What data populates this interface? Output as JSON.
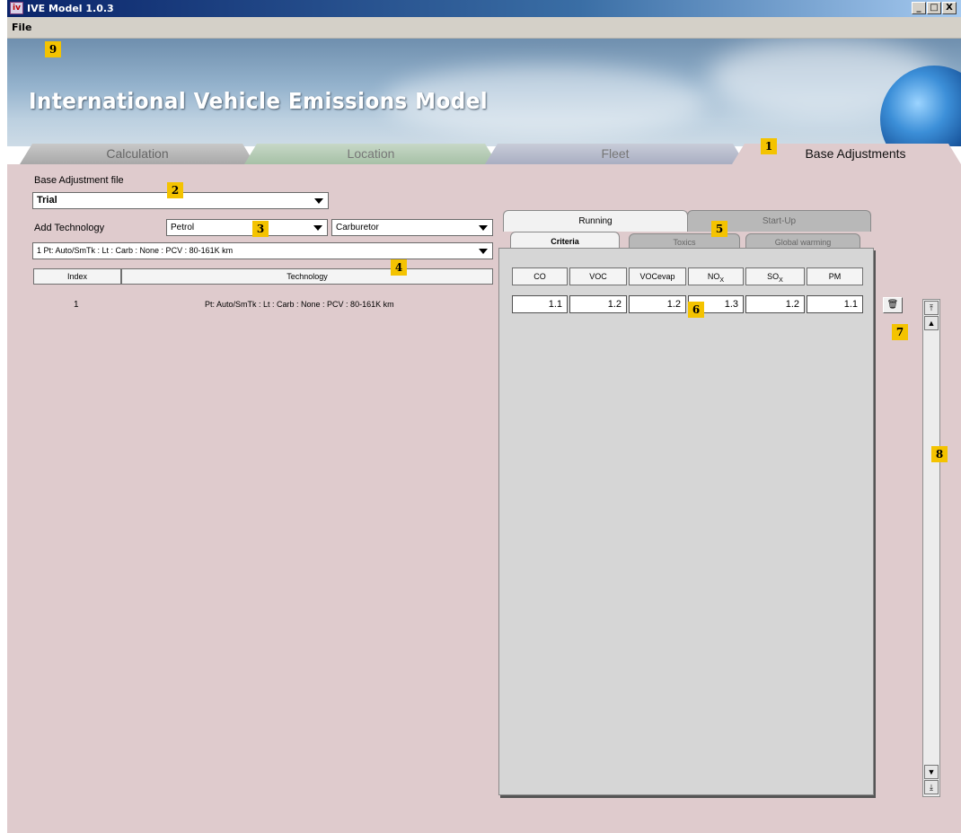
{
  "window": {
    "title": "IVE Model 1.0.3",
    "app_icon_glyph": "iv",
    "minimize_glyph": "_",
    "maximize_glyph": "□",
    "close_glyph": "X"
  },
  "menu": {
    "file_label": "File"
  },
  "banner": {
    "heading": "International Vehicle Emissions Model"
  },
  "top_tabs": [
    {
      "label": "Calculation"
    },
    {
      "label": "Location"
    },
    {
      "label": "Fleet"
    },
    {
      "label": "Base Adjustments"
    }
  ],
  "base_adjustment": {
    "file_label": "Base Adjustment file",
    "file_value": "Trial"
  },
  "add_technology": {
    "label": "Add Technology",
    "fuel_value": "Petrol",
    "type_value": "Carburetor",
    "technology_value": "1  Pt: Auto/SmTk : Lt : Carb : None : PCV : 80-161K km"
  },
  "tech_table": {
    "headers": [
      "Index",
      "Technology"
    ],
    "rows": [
      {
        "index": "1",
        "technology": "Pt: Auto/SmTk : Lt : Carb : None : PCV : 80-161K km"
      }
    ]
  },
  "panel_tabs": {
    "primary": [
      "Running",
      "Start-Up"
    ],
    "secondary": [
      "Criteria",
      "Toxics",
      "Global warming"
    ]
  },
  "criteria": {
    "columns": [
      "CO",
      "VOC",
      "VOCevap",
      "NO",
      "SO",
      "PM"
    ],
    "subscript": "X",
    "values": [
      "1.1",
      "1.2",
      "1.2",
      "1.3",
      "1.2",
      "1.1"
    ]
  },
  "delete_button_glyph": "🗑",
  "scrollbar": {
    "top_glyph": "⤒",
    "up_glyph": "▲",
    "down_glyph": "▼",
    "bottom_glyph": "⤓"
  },
  "callouts": [
    "1",
    "2",
    "3",
    "4",
    "5",
    "6",
    "7",
    "8",
    "9"
  ],
  "colors": {
    "panel_bg": "#dfcbcd",
    "title_bar": "#0a246a",
    "callout": "#f4c300"
  }
}
